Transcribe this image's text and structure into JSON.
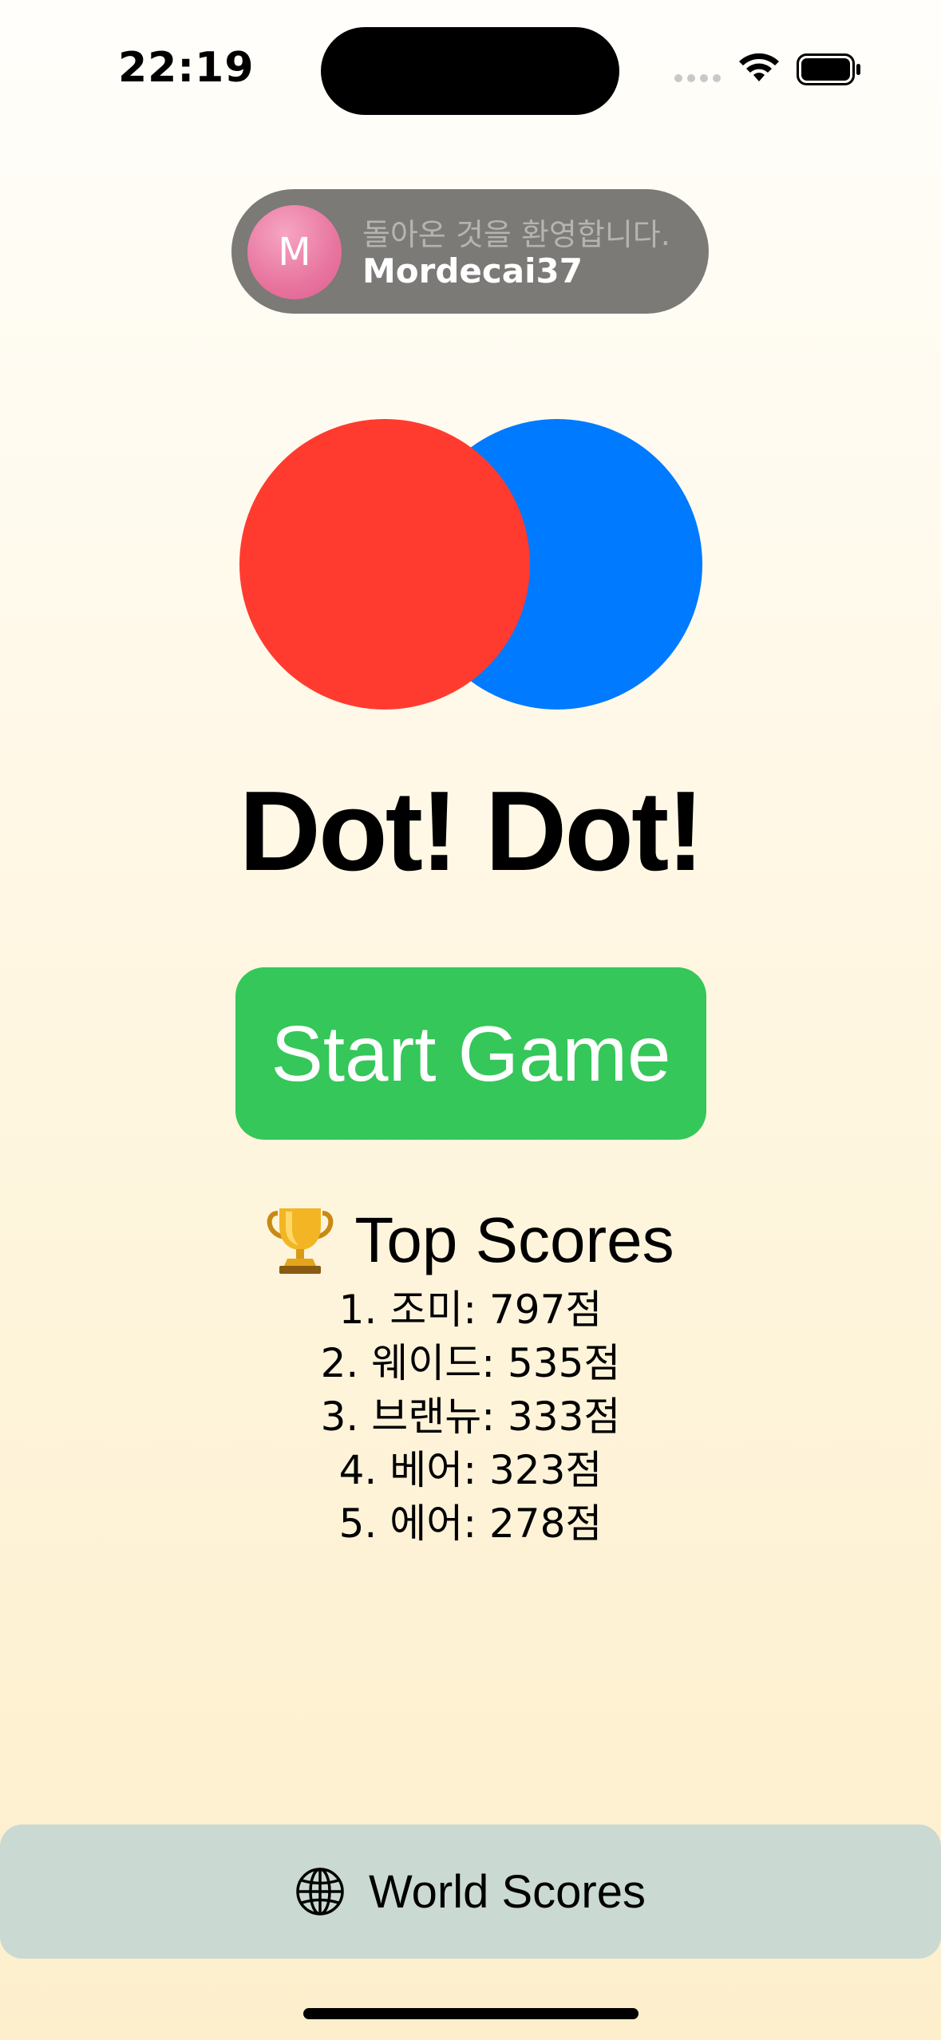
{
  "status_bar": {
    "time": "22:19"
  },
  "toast": {
    "avatar_initial": "M",
    "greeting": "돌아온 것을 환영합니다.",
    "username": "Mordecai37"
  },
  "logo": {
    "left_circle_color": "#ff3b30",
    "right_circle_color": "#007aff"
  },
  "title": "Dot! Dot!",
  "start_button": {
    "label": "Start Game",
    "color": "#35c759"
  },
  "top_scores": {
    "heading": "Top Scores",
    "icon": "trophy-icon",
    "entries": [
      "1. 조미: 797점",
      "2. 웨이드: 535점",
      "3. 브랜뉴: 333점",
      "4. 베어: 323점",
      "5. 에어: 278점"
    ]
  },
  "world_scores_button": {
    "label": "World Scores",
    "icon": "globe-icon"
  }
}
